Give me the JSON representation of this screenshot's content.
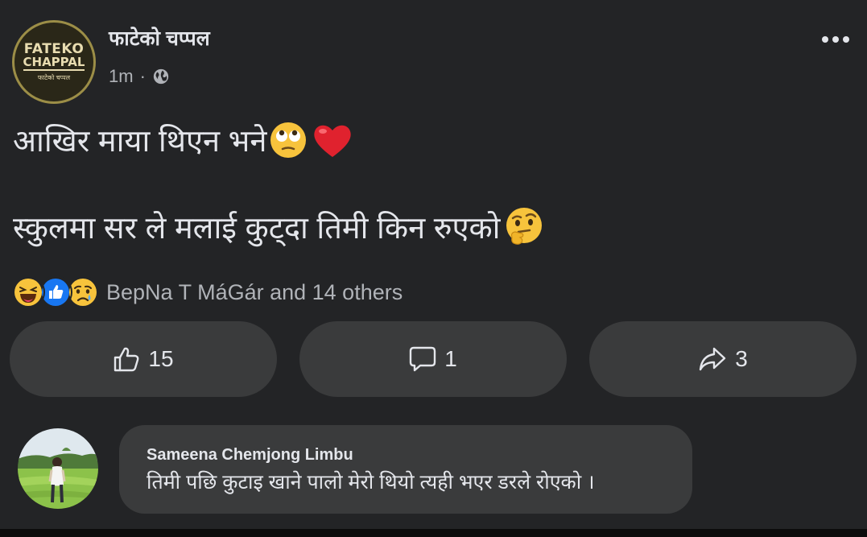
{
  "post": {
    "page_name": "फाटेको चप्पल",
    "time": "1m",
    "separator": "·",
    "visibility_icon": "globe-icon",
    "more_icon": "ellipsis-icon",
    "logo": {
      "line1": "FATEKO",
      "line2": "CHAPPAL",
      "line3": "फाटेको चप्पल"
    },
    "line1": "आखिर माया  थिएन भने",
    "line1_emojis": [
      "face-with-rolling-eyes-emoji",
      "red-heart-emoji"
    ],
    "line2": "स्कुलमा सर ले मलाई कुट्दा तिमी किन रुएको",
    "line2_emojis": [
      "thinking-face-emoji"
    ]
  },
  "reactions": {
    "icons": [
      "haha-reaction-icon",
      "like-reaction-icon",
      "sad-reaction-icon"
    ],
    "summary": "BepNa T MáGár and 14 others"
  },
  "actions": {
    "like_count": "15",
    "comment_count": "1",
    "share_count": "3"
  },
  "comment": {
    "author": "Sameena Chemjong Limbu",
    "text": "तिमी पछि कुटाइ खाने पालो मेरो थियो त्यही भएर डरले रोएको ।"
  },
  "colors": {
    "background": "#232426",
    "button_bg": "#3a3b3c",
    "text_primary": "#e4e6eb",
    "text_secondary": "#b0b3b8",
    "like_blue": "#1877f2",
    "heart_red": "#f02849",
    "emoji_yellow": "#f7c33c"
  }
}
